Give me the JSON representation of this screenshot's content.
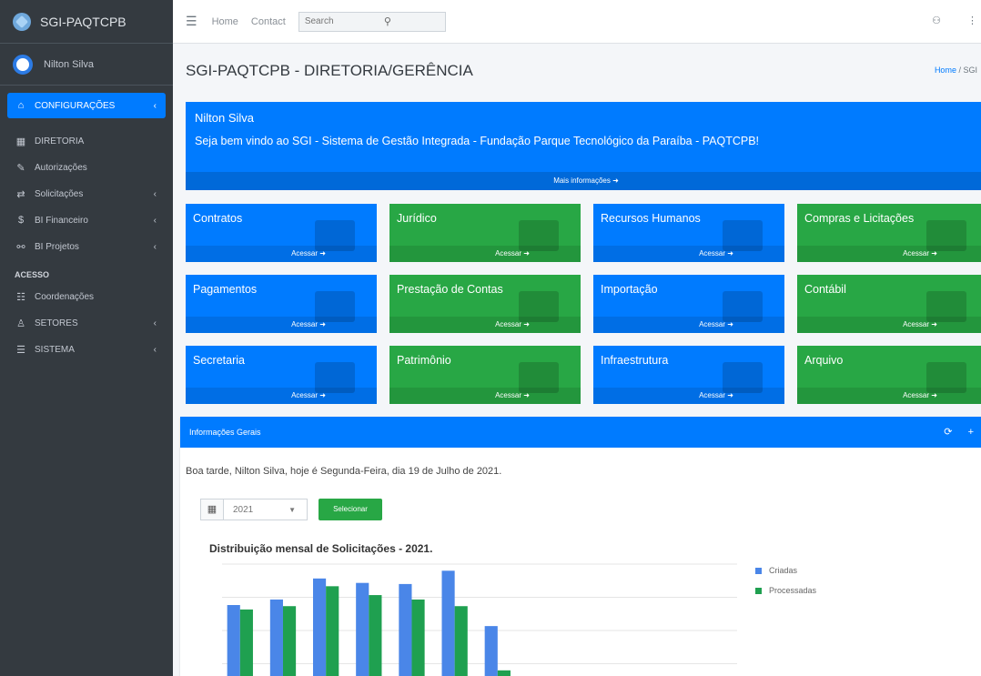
{
  "brand": {
    "name": "SGI-PAQTCPB"
  },
  "user": {
    "name": "Nilton Silva"
  },
  "sidebar": {
    "items": [
      {
        "label": "CONFIGURAÇÕES",
        "icon": "dashboard-icon",
        "glyph": "⌂",
        "chevron": "‹",
        "active": true
      },
      {
        "label": "DIRETORIA",
        "icon": "table-icon",
        "glyph": "▦",
        "chevron": ""
      },
      {
        "label": "Autorizações",
        "icon": "pen-icon",
        "glyph": "✎",
        "chevron": ""
      },
      {
        "label": "Solicitações",
        "icon": "flow-icon",
        "glyph": "⇄",
        "chevron": "‹"
      },
      {
        "label": "BI Financeiro",
        "icon": "money-icon",
        "glyph": "$",
        "chevron": "‹"
      },
      {
        "label": "BI Projetos",
        "icon": "network-icon",
        "glyph": "⚯",
        "chevron": "‹"
      }
    ],
    "section_header": "ACESSO",
    "section_items": [
      {
        "label": "Coordenações",
        "icon": "users-icon",
        "glyph": "☷",
        "chevron": ""
      },
      {
        "label": "SETORES",
        "icon": "sitemap-icon",
        "glyph": "♙",
        "chevron": "‹"
      },
      {
        "label": "SISTEMA",
        "icon": "server-icon",
        "glyph": "☰",
        "chevron": "‹"
      }
    ]
  },
  "topbar": {
    "menu_icon": "☰",
    "links": [
      "Home",
      "Contact"
    ],
    "search_placeholder": "Search",
    "search_icon": "⚲",
    "right_icons": [
      "⚇",
      "⋮"
    ]
  },
  "page": {
    "title": "SGI-PAQTCPB - DIRETORIA/GERÊNCIA",
    "breadcrumb": [
      "Home",
      "SGI"
    ]
  },
  "welcome": {
    "name": "Nilton Silva",
    "message": "Seja bem vindo ao SGI - Sistema de Gestão Integrada - Fundação Parque Tecnológico da Paraíba - PAQTCPB!",
    "more": "Mais informações ➜"
  },
  "boxes": [
    {
      "title": "Contratos",
      "color": "blue",
      "action": "Acessar ➜",
      "icon": "building-icon"
    },
    {
      "title": "Jurídico",
      "color": "green",
      "action": "Acessar ➜",
      "icon": "court-icon"
    },
    {
      "title": "Recursos Humanos",
      "color": "blue",
      "action": "Acessar ➜",
      "icon": "people-icon"
    },
    {
      "title": "Compras e Licitações",
      "color": "green",
      "action": "Acessar ➜",
      "icon": "cart-icon"
    },
    {
      "title": "Pagamentos",
      "color": "blue",
      "action": "Acessar ➜",
      "icon": "money-stack-icon"
    },
    {
      "title": "Prestação de Contas",
      "color": "green",
      "action": "Acessar ➜",
      "icon": "invoice-icon"
    },
    {
      "title": "Importação",
      "color": "blue",
      "action": "Acessar ➜",
      "icon": "ship-icon"
    },
    {
      "title": "Contábil",
      "color": "green",
      "action": "Acessar ➜",
      "icon": "calculator-icon"
    },
    {
      "title": "Secretaria",
      "color": "blue",
      "action": "Acessar ➜",
      "icon": "user-tie-icon"
    },
    {
      "title": "Patrimônio",
      "color": "green",
      "action": "Acessar ➜",
      "icon": "thumbtack-icon"
    },
    {
      "title": "Infraestrutura",
      "color": "blue",
      "action": "Acessar ➜",
      "icon": "tools-icon"
    },
    {
      "title": "Arquivo",
      "color": "green",
      "action": "Acessar ➜",
      "icon": "folder-icon"
    }
  ],
  "info_card": {
    "title": "Informações Gerais",
    "tools": [
      "⟳",
      "+"
    ],
    "greeting": "Boa tarde, Nilton Silva, hoje é Segunda-Feira, dia 19 de Julho de 2021.",
    "calendar_icon": "▦",
    "year_value": "2021",
    "select_label": "Selecionar"
  },
  "colors": {
    "blue": "#007bff",
    "green": "#28a745",
    "sidebar": "#343a40"
  },
  "chart_data": {
    "type": "bar",
    "title": "Distribuição mensal de Solicitações - 2021.",
    "categories": [
      "",
      "",
      "",
      "",
      "",
      "",
      "",
      "",
      "",
      "",
      "",
      ""
    ],
    "series": [
      {
        "name": "Criadas",
        "color": "#4a86e8",
        "values": [
          415,
          440,
          535,
          515,
          510,
          570,
          320,
          0,
          0,
          0,
          0,
          0
        ]
      },
      {
        "name": "Processadas",
        "color": "#1fa050",
        "values": [
          395,
          410,
          500,
          460,
          440,
          410,
          120,
          0,
          0,
          0,
          0,
          0
        ]
      }
    ],
    "ylim": [
      0,
      600
    ],
    "yticks": [
      "",
      "",
      "",
      ""
    ],
    "legend_position": "right",
    "grid": true
  }
}
